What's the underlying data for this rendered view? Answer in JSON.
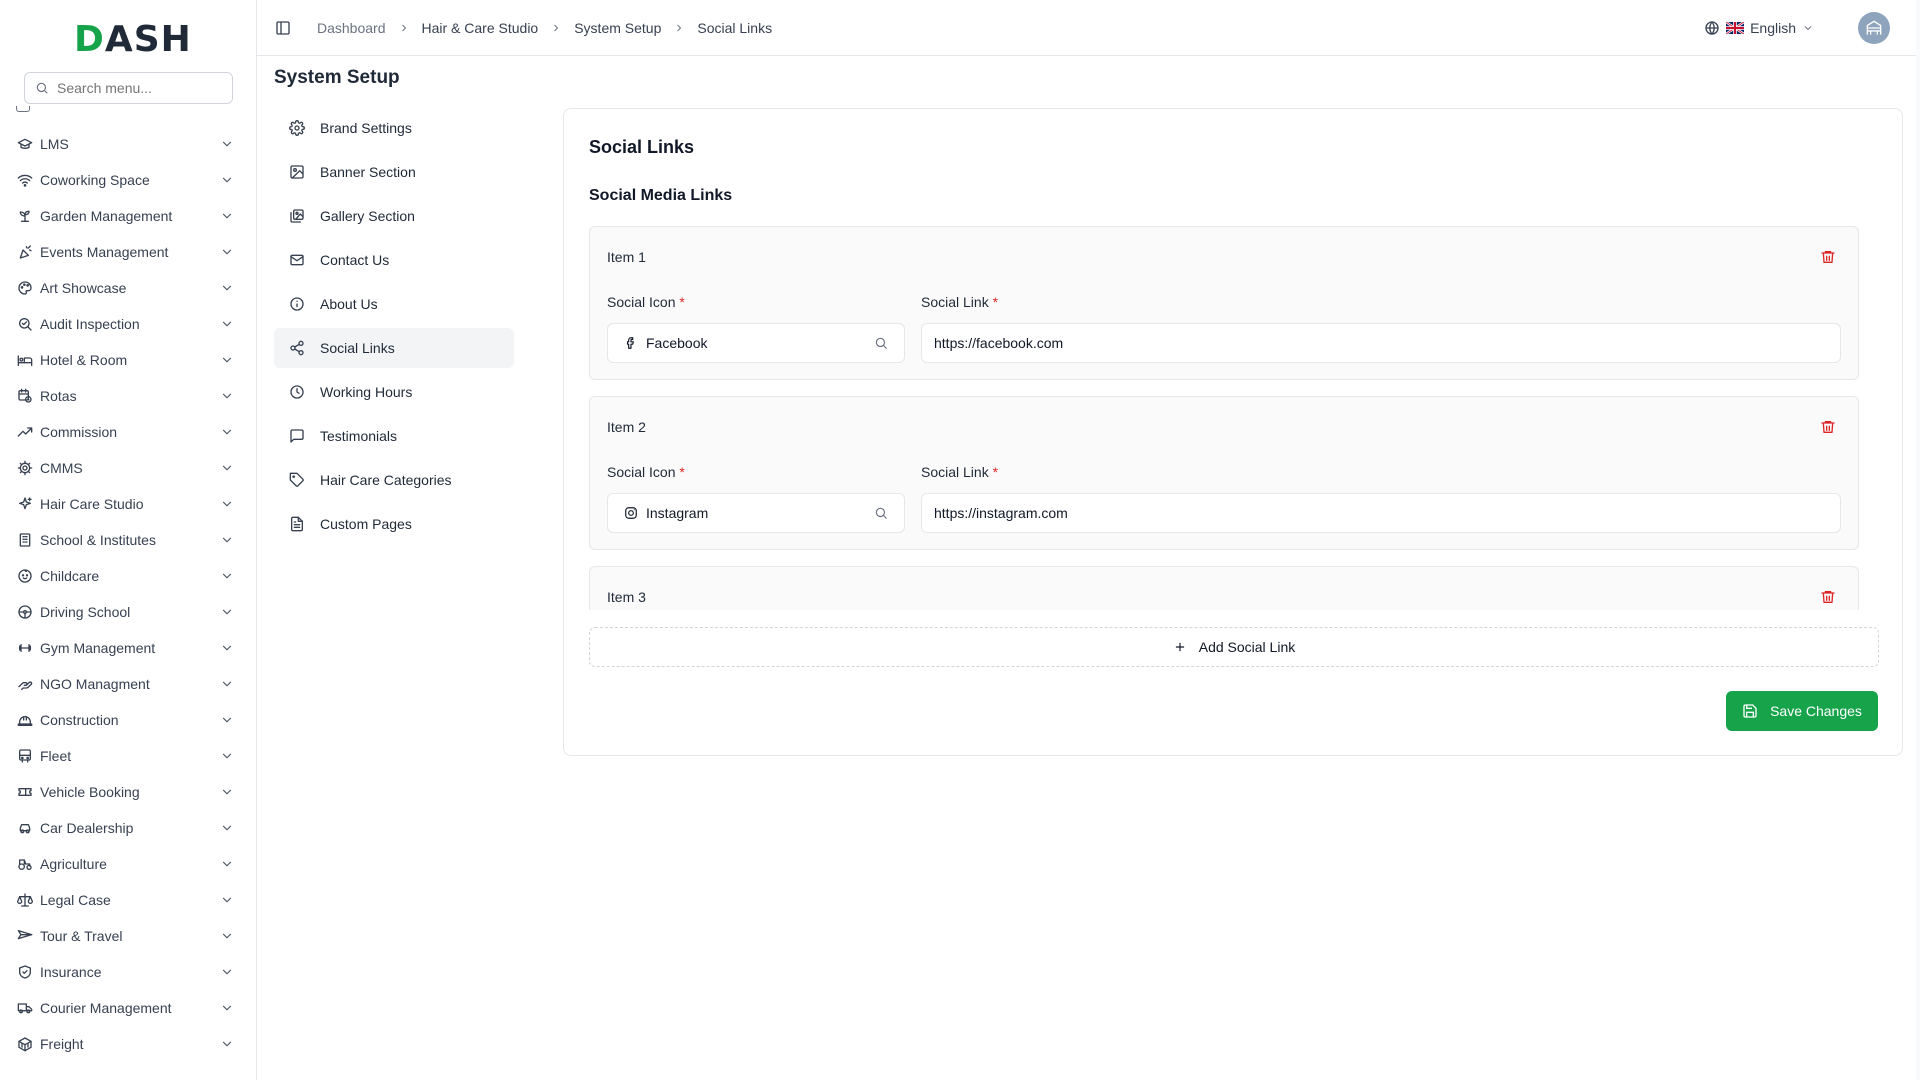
{
  "app": {
    "logo_text": "DASH",
    "accent_color": "#16a34a",
    "danger_color": "#dc2626"
  },
  "sidebar": {
    "search_placeholder": "Search menu...",
    "items": [
      {
        "label": "LMS",
        "icon": "graduation-cap-icon"
      },
      {
        "label": "Coworking Space",
        "icon": "wifi-icon"
      },
      {
        "label": "Garden Management",
        "icon": "sprout-icon"
      },
      {
        "label": "Events Management",
        "icon": "party-popper-icon"
      },
      {
        "label": "Art Showcase",
        "icon": "palette-icon"
      },
      {
        "label": "Audit Inspection",
        "icon": "search-check-icon"
      },
      {
        "label": "Hotel & Room",
        "icon": "bed-icon"
      },
      {
        "label": "Rotas",
        "icon": "calendar-clock-icon"
      },
      {
        "label": "Commission",
        "icon": "trending-up-icon"
      },
      {
        "label": "CMMS",
        "icon": "cog-icon"
      },
      {
        "label": "Hair Care Studio",
        "icon": "sparkles-icon"
      },
      {
        "label": "School & Institutes",
        "icon": "building-icon"
      },
      {
        "label": "Childcare",
        "icon": "baby-icon"
      },
      {
        "label": "Driving School",
        "icon": "steering-wheel-icon"
      },
      {
        "label": "Gym Management",
        "icon": "dumbbell-icon"
      },
      {
        "label": "NGO Managment",
        "icon": "hand-heart-icon"
      },
      {
        "label": "Construction",
        "icon": "hard-hat-icon"
      },
      {
        "label": "Fleet",
        "icon": "bus-icon"
      },
      {
        "label": "Vehicle Booking",
        "icon": "ticket-icon"
      },
      {
        "label": "Car Dealership",
        "icon": "car-icon"
      },
      {
        "label": "Agriculture",
        "icon": "tractor-icon"
      },
      {
        "label": "Legal Case",
        "icon": "scale-icon"
      },
      {
        "label": "Tour & Travel",
        "icon": "plane-icon"
      },
      {
        "label": "Insurance",
        "icon": "shield-icon"
      },
      {
        "label": "Courier Management",
        "icon": "truck-icon"
      },
      {
        "label": "Freight",
        "icon": "container-icon"
      }
    ]
  },
  "header": {
    "breadcrumb": [
      "Dashboard",
      "Hair & Care Studio",
      "System Setup",
      "Social Links"
    ],
    "language": "English"
  },
  "page": {
    "title": "System Setup"
  },
  "subnav": {
    "active_index": 5,
    "items": [
      {
        "label": "Brand Settings",
        "icon": "settings-icon"
      },
      {
        "label": "Banner Section",
        "icon": "image-icon"
      },
      {
        "label": "Gallery Section",
        "icon": "images-icon"
      },
      {
        "label": "Contact Us",
        "icon": "mail-icon"
      },
      {
        "label": "About Us",
        "icon": "info-icon"
      },
      {
        "label": "Social Links",
        "icon": "share-icon"
      },
      {
        "label": "Working Hours",
        "icon": "clock-icon"
      },
      {
        "label": "Testimonials",
        "icon": "message-square-icon"
      },
      {
        "label": "Hair Care Categories",
        "icon": "tag-icon"
      },
      {
        "label": "Custom Pages",
        "icon": "file-text-icon"
      }
    ]
  },
  "card": {
    "title": "Social Links",
    "section_title": "Social Media Links",
    "icon_label": "Social Icon",
    "link_label": "Social Link",
    "required_mark": "*",
    "items": [
      {
        "title": "Item 1",
        "icon_value": "Facebook",
        "icon": "facebook-icon",
        "link": "https://facebook.com"
      },
      {
        "title": "Item 2",
        "icon_value": "Instagram",
        "icon": "instagram-icon",
        "link": "https://instagram.com"
      },
      {
        "title": "Item 3",
        "icon_value": "",
        "icon": "",
        "link": ""
      }
    ],
    "add_label": "Add Social Link",
    "save_label": "Save Changes"
  }
}
